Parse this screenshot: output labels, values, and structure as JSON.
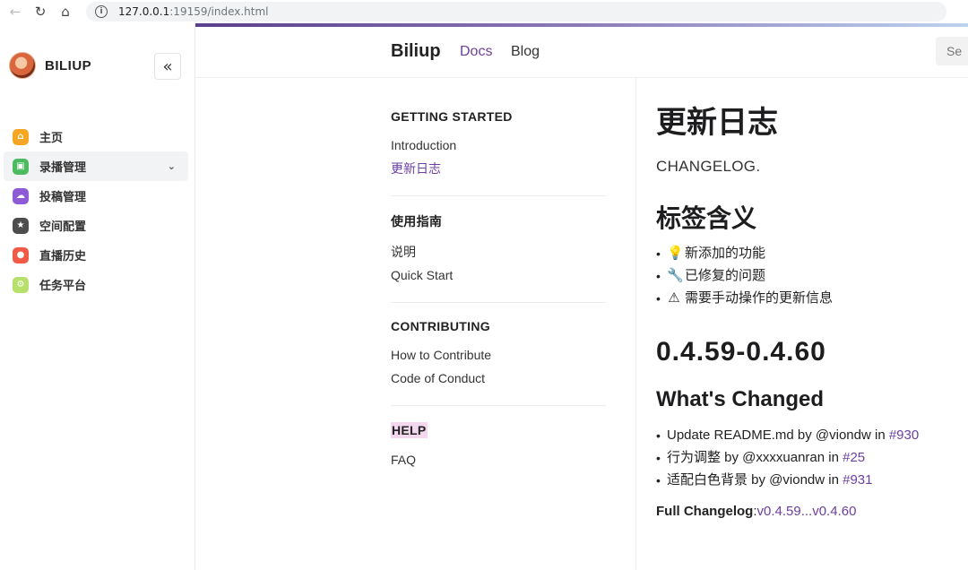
{
  "browser": {
    "url_host": "127.0.0.1",
    "url_path": ":19159/index.html"
  },
  "sidebar": {
    "brand": "BILIUP",
    "collapse_glyph": "«",
    "items": [
      {
        "label": "主页",
        "icon": "home-icon",
        "color": "#f5a623"
      },
      {
        "label": "录播管理",
        "icon": "record-icon",
        "color": "#4cba5f",
        "active": true
      },
      {
        "label": "投稿管理",
        "icon": "cloud-icon",
        "color": "#8e5bd6"
      },
      {
        "label": "空间配置",
        "icon": "star-icon",
        "color": "#4d4d4d"
      },
      {
        "label": "直播历史",
        "icon": "live-icon",
        "color": "#ef5b45"
      },
      {
        "label": "任务平台",
        "icon": "task-icon",
        "color": "#b7e06b"
      }
    ]
  },
  "docs_header": {
    "logo": "Biliup",
    "docs": "Docs",
    "blog": "Blog",
    "search_placeholder": "Se"
  },
  "docs_nav": {
    "sections": [
      {
        "title": "GETTING STARTED",
        "links": [
          "Introduction",
          "更新日志"
        ]
      },
      {
        "title": "使用指南",
        "links": [
          "说明",
          "Quick Start"
        ]
      },
      {
        "title": "CONTRIBUTING",
        "links": [
          "How to Contribute",
          "Code of Conduct"
        ]
      },
      {
        "title": "HELP",
        "links": [
          "FAQ"
        ]
      }
    ]
  },
  "content": {
    "title": "更新日志",
    "subtitle": "CHANGELOG.",
    "tags_heading": "标签含义",
    "tags": [
      {
        "emoji": "💡",
        "text": "新添加的功能"
      },
      {
        "emoji": "🔧",
        "text": "已修复的问题"
      },
      {
        "emoji": "⚠",
        "text": "需要手动操作的更新信息"
      }
    ],
    "version": "0.4.59-0.4.60",
    "whats_changed": "What's Changed",
    "changes": [
      {
        "text": "Update README.md by @viondw in ",
        "pr": "#930"
      },
      {
        "text": "行为调整 by @xxxxuanran in ",
        "pr": "#25"
      },
      {
        "text": "适配白色背景 by @viondw in ",
        "pr": "#931"
      }
    ],
    "full_changelog_label": "Full Changelog",
    "full_changelog_sep": ":",
    "full_changelog_range": "v0.4.59...v0.4.60"
  },
  "colors": {
    "accent": "#6b3fa0",
    "help_highlight": "#f2d7ee"
  }
}
